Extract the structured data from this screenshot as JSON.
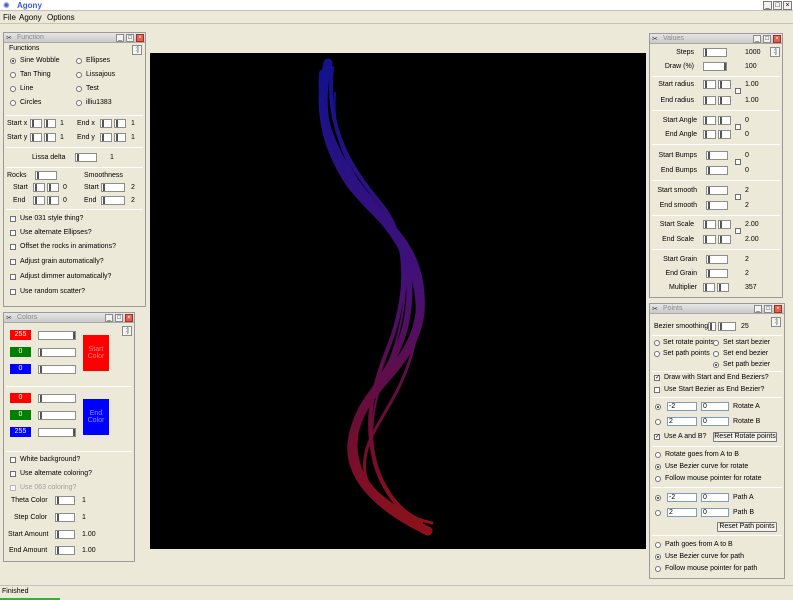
{
  "app": {
    "title": "Agony",
    "status": "Finished"
  },
  "menu": {
    "file": "File",
    "agony": "Agony",
    "options": "Options"
  },
  "function_panel": {
    "title": "Function",
    "group": "Functions",
    "options": [
      "Sine Wobble",
      "Ellipses",
      "Tan Thing",
      "Lissajous",
      "Line",
      "Test",
      "Circles",
      "illiu1383"
    ],
    "start_x": "Start x",
    "end_x": "End x",
    "start_y": "Start y",
    "end_y": "End y",
    "one": "1",
    "lissa_delta": "Lissa delta",
    "lissa_val": "1",
    "rocks": "Rocks",
    "smoothness": "Smoothness",
    "start": "Start",
    "end": "End",
    "zero": "0",
    "two": "2",
    "checks": [
      "Use 031 style thing?",
      "Use alternate Ellipses?",
      "Offset the rocks in animations?",
      "Adjust grain automatically?",
      "Adjust dimmer automatically?",
      "Use random scatter?"
    ]
  },
  "colors_panel": {
    "title": "Colors",
    "r1": "255",
    "g1": "0",
    "b1": "0",
    "start_label": "Start Color",
    "r2": "0",
    "g2": "0",
    "b2": "255",
    "end_label": "End Color",
    "checks": [
      "White background?",
      "Use alternate coloring?",
      "Use 063 coloring?"
    ],
    "theta": "Theta Color",
    "theta_val": "1",
    "step": "Step Color",
    "step_val": "1",
    "start_amount": "Start Amount",
    "start_amount_val": "1.00",
    "end_amount": "End Amount",
    "end_amount_val": "1.00",
    "start_color": "#ff0000",
    "end_color": "#0000ff"
  },
  "values_panel": {
    "title": "Values",
    "rows": [
      {
        "label": "Steps",
        "value": "1000"
      },
      {
        "label": "Draw (%)",
        "value": "100"
      },
      {
        "label": "Start radius",
        "value": "1.00"
      },
      {
        "label": "End radius",
        "value": "1.00"
      },
      {
        "label": "Start Angle",
        "value": "0"
      },
      {
        "label": "End Angle",
        "value": "0"
      },
      {
        "label": "Start Bumps",
        "value": "0"
      },
      {
        "label": "End Bumps",
        "value": "0"
      },
      {
        "label": "Start smooth",
        "value": "2"
      },
      {
        "label": "End smooth",
        "value": "2"
      },
      {
        "label": "Start Scale",
        "value": "2.00"
      },
      {
        "label": "End Scale",
        "value": "2.00"
      },
      {
        "label": "Start Grain",
        "value": "2"
      },
      {
        "label": "End Grain",
        "value": "2"
      },
      {
        "label": "Multiplier",
        "value": "357"
      }
    ]
  },
  "points_panel": {
    "title": "Points",
    "bezier_smoothing": "Bezier smoothing",
    "bezier_val": "25",
    "radio_left": [
      "Set rotate points",
      "Set path points"
    ],
    "radio_right": [
      "Set start bezier",
      "Set end bezier",
      "Set path bezier"
    ],
    "draw_with": "Draw with Start and End Beziers?",
    "use_start_bezier": "Use Start Bezier as End Bezier?",
    "rotate_a_x": "-2",
    "rotate_a_y": "0",
    "rotate_a": "Rotate A",
    "rotate_b_x": "2",
    "rotate_b_y": "0",
    "rotate_b": "Rotate B",
    "use_ab": "Use A and B?",
    "reset_rotate": "Reset Rotate points",
    "rotate_options": [
      "Rotate goes from A to B",
      "Use Bezier curve for rotate",
      "Follow mouse pointer for rotate"
    ],
    "path_a_x": "-2",
    "path_a_y": "0",
    "path_a": "Path A",
    "path_b_x": "2",
    "path_b_y": "0",
    "path_b": "Path B",
    "reset_path": "Reset Path points",
    "path_options": [
      "Path goes from A to B",
      "Use Bezier curve for path",
      "Follow mouse pointer for path"
    ]
  }
}
